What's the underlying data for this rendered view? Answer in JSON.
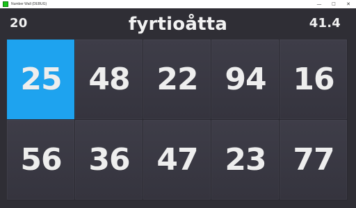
{
  "window": {
    "title": "Number Wall (DEBUG)",
    "controls": {
      "minimize": "—",
      "maximize": "□",
      "close": "✕"
    }
  },
  "hud": {
    "left": "20",
    "prompt": "fyrtioåtta",
    "right": "41.4"
  },
  "board": {
    "tiles": [
      {
        "number": "25",
        "selected": true
      },
      {
        "number": "48",
        "selected": false
      },
      {
        "number": "22",
        "selected": false
      },
      {
        "number": "94",
        "selected": false
      },
      {
        "number": "16",
        "selected": false
      },
      {
        "number": "56",
        "selected": false
      },
      {
        "number": "36",
        "selected": false
      },
      {
        "number": "47",
        "selected": false
      },
      {
        "number": "23",
        "selected": false
      },
      {
        "number": "77",
        "selected": false
      }
    ]
  },
  "colors": {
    "background": "#2f2e35",
    "tile": "#3a3944",
    "selected_tile": "#1ea3ef",
    "text": "#eeeeee",
    "app_icon": "#19c319"
  }
}
